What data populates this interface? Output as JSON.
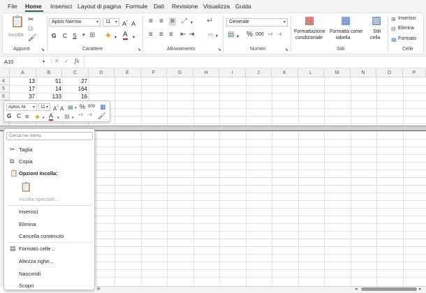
{
  "tabs": [
    "File",
    "Home",
    "Inserisci",
    "Layout di pagina",
    "Formule",
    "Dati",
    "Revisione",
    "Visualizza",
    "Guida"
  ],
  "ribbon": {
    "paste_label": "Incolla",
    "clipboard_label": "Appunti",
    "font_name": "Aptos Narrow",
    "font_size": "11",
    "bold": "G",
    "italic": "C",
    "underline": "S",
    "font_group_label": "Carattere",
    "alignment_group_label": "Allineamento",
    "number_format": "Generale",
    "percent": "%",
    "thousands": "000",
    "number_group_label": "Numeri",
    "cond_format_line1": "Formattazione",
    "cond_format_line2": "condizionale",
    "format_table_line1": "Formatta come",
    "format_table_line2": "tabella",
    "cell_styles_line1": "Stili",
    "cell_styles_line2": "cella",
    "styles_group_label": "Stili",
    "insert": "Inserisci",
    "delete": "Elimina",
    "format": "Formato",
    "cells_group_label": "Celle"
  },
  "formula_bar": {
    "name_box": "A10",
    "fx": "fx",
    "cancel": "✕",
    "confirm": "✓"
  },
  "columns": [
    "A",
    "B",
    "C",
    "D",
    "E",
    "F",
    "G",
    "H",
    "I",
    "J",
    "K",
    "L",
    "M",
    "N",
    "O",
    "P"
  ],
  "rows": [
    {
      "num": "4",
      "a": "13",
      "b": "51",
      "c": "27"
    },
    {
      "num": "5",
      "a": "17",
      "b": "14",
      "c": "164"
    },
    {
      "num": "6",
      "a": "37",
      "b": "133",
      "c": "16"
    }
  ],
  "mini_toolbar": {
    "font_name": "Aptos Ni",
    "font_size": "11",
    "bold": "G",
    "italic": "C",
    "percent": "%",
    "thousands": "000"
  },
  "context_menu": {
    "search_placeholder": "Cerca nei menu",
    "cut": "Taglia",
    "copy": "Copia",
    "paste_options": "Opzioni Incolla:",
    "paste_special": "Incolla speciale...",
    "insert": "Inserisci",
    "delete": "Elimina",
    "clear_contents": "Cancella contenuto",
    "format_cells": "Formato celle...",
    "row_height": "Altezza righe...",
    "hide": "Nascondi",
    "unhide": "Scopri"
  },
  "colors": {
    "accent": "#1e6e3c",
    "selection_band": "#d2d2d2"
  }
}
